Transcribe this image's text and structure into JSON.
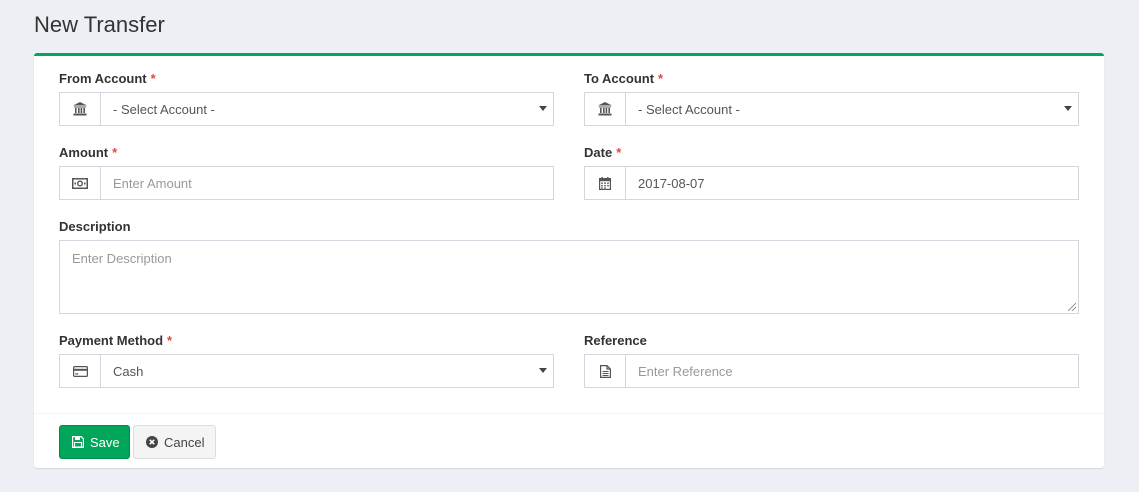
{
  "header": {
    "title": "New Transfer"
  },
  "form": {
    "from_account": {
      "label": "From Account",
      "required_mark": "*",
      "value": "- Select Account -",
      "icon": "bank-icon"
    },
    "to_account": {
      "label": "To Account",
      "required_mark": "*",
      "value": "- Select Account -",
      "icon": "bank-icon"
    },
    "amount": {
      "label": "Amount",
      "required_mark": "*",
      "placeholder": "Enter Amount",
      "value": "",
      "icon": "money-icon"
    },
    "date": {
      "label": "Date",
      "required_mark": "*",
      "value": "2017-08-07",
      "icon": "calendar-icon"
    },
    "description": {
      "label": "Description",
      "placeholder": "Enter Description",
      "value": ""
    },
    "payment_method": {
      "label": "Payment Method",
      "required_mark": "*",
      "value": "Cash",
      "icon": "credit-card-icon"
    },
    "reference": {
      "label": "Reference",
      "placeholder": "Enter Reference",
      "value": "",
      "icon": "document-icon"
    }
  },
  "footer": {
    "save_label": "Save",
    "cancel_label": "Cancel"
  },
  "colors": {
    "accent": "#00a65a",
    "required": "#dd4b39",
    "background": "#ecf0f5"
  }
}
